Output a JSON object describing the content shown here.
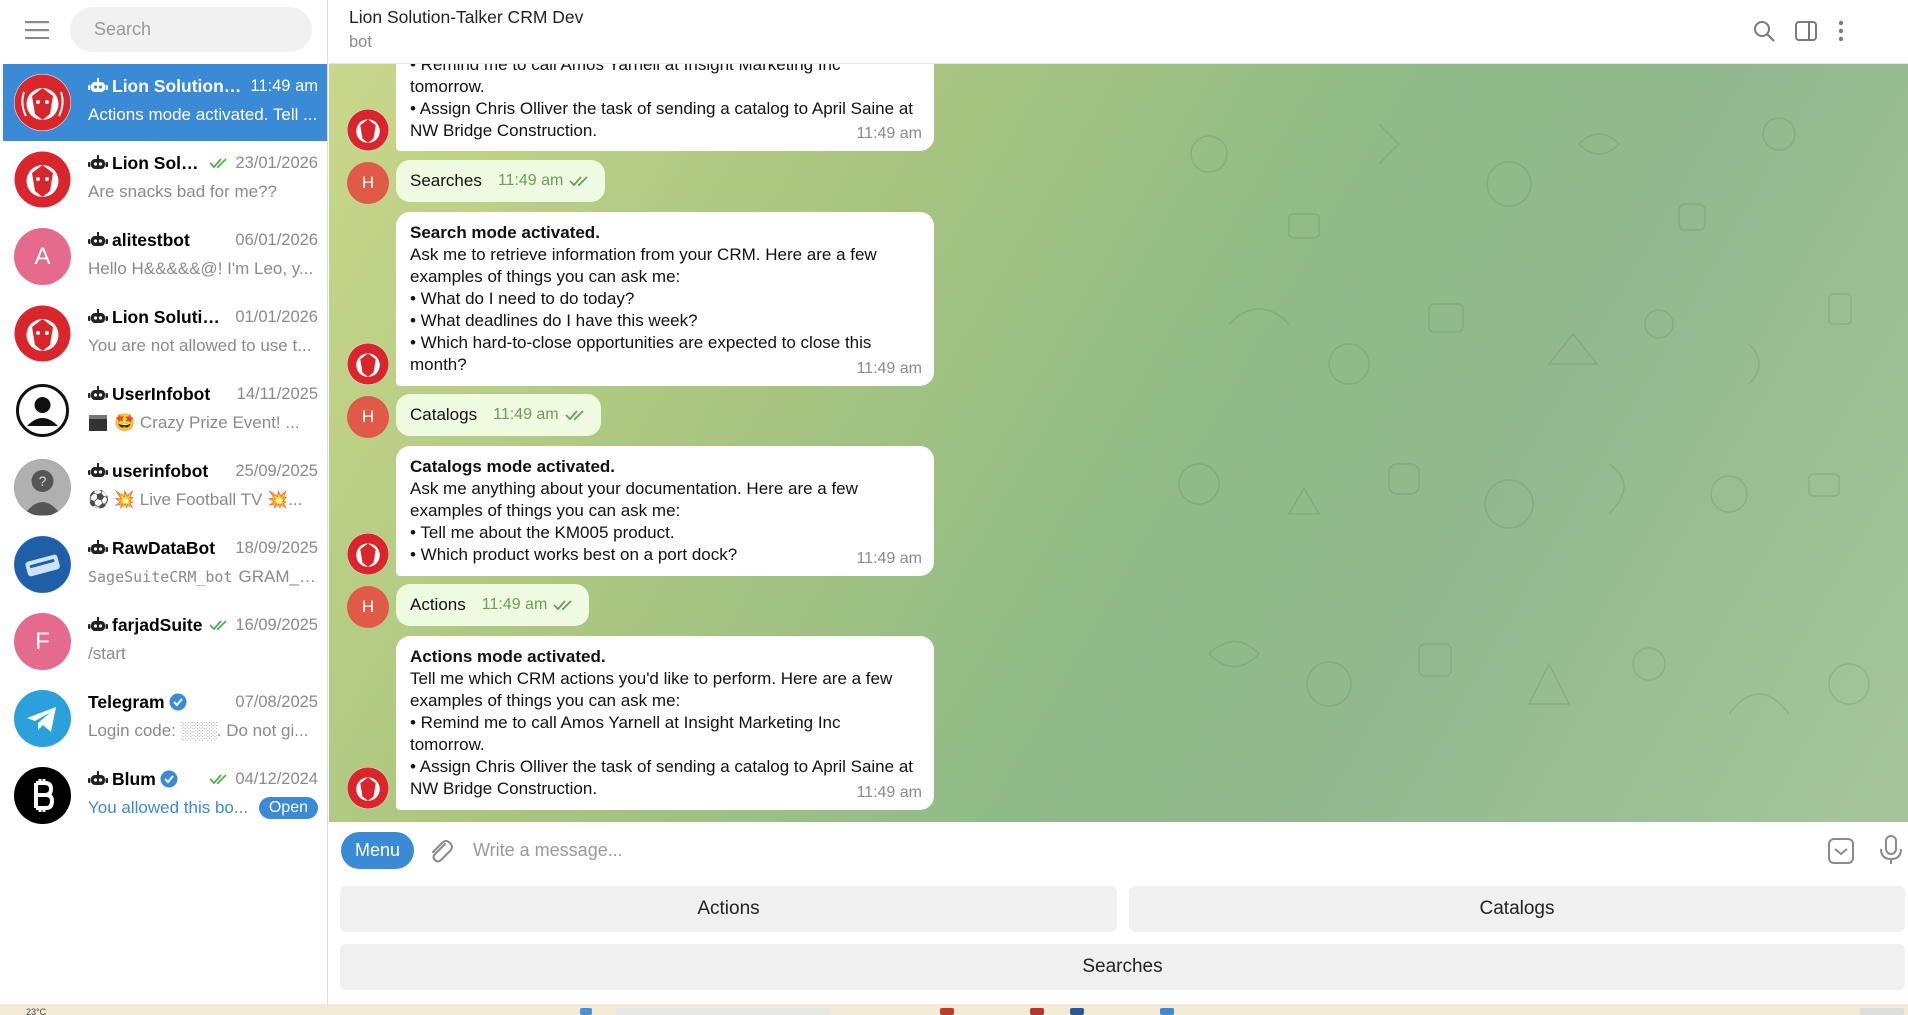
{
  "sidebar": {
    "search_placeholder": "Search",
    "chats": [
      {
        "name": "Lion Solution-T...",
        "date": "11:49 am",
        "preview": "Actions mode activated. Tell ...",
        "active": true,
        "avatar": "lion"
      },
      {
        "name": "Lion Solut...",
        "date": "23/01/2026",
        "preview": "Are snacks bad for me??",
        "read": true,
        "avatar": "lion"
      },
      {
        "name": "alitestbot",
        "date": "06/01/2026",
        "preview": "Hello H&&&&&@! I'm Leo, y...",
        "avatar_letter": "A"
      },
      {
        "name": "Lion Solution...",
        "date": "01/01/2026",
        "preview": "You are not allowed to use t...",
        "avatar": "lion"
      },
      {
        "name": "UserInfobot",
        "date": "14/11/2025",
        "preview": "🤩 Crazy Prize Event! ...",
        "avatar": "user-outline"
      },
      {
        "name": "userinfobot",
        "date": "25/09/2025",
        "preview": "⚽ 💥 Live Football TV 💥...",
        "avatar": "user-gray"
      },
      {
        "name": "RawDataBot",
        "date": "18/09/2025",
        "preview_code": "SageSuiteCRM_bot",
        "preview": "GRAM_A...",
        "avatar": "rawdata"
      },
      {
        "name": "farjadSuite",
        "date": "16/09/2025",
        "preview": "/start",
        "read": true,
        "avatar_letter": "F"
      },
      {
        "name": "Telegram",
        "date": "07/08/2025",
        "preview": "Login code: ░░░. Do not gi...",
        "verified": true,
        "avatar": "telegram"
      },
      {
        "name": "Blum",
        "date": "04/12/2024",
        "preview": "You allowed this bo...",
        "read": true,
        "verified": true,
        "open_label": "Open",
        "avatar": "blum"
      }
    ]
  },
  "header": {
    "title": "Lion Solution-Talker CRM Dev",
    "subtitle": "bot"
  },
  "messages": {
    "top_partial": {
      "line1": "• Remind me to call Amos Yarnell at Insight Marketing Inc",
      "line2": "tomorrow.",
      "line3": "• Assign Chris Olliver the task of sending a catalog to April Saine at",
      "line4": "NW Bridge Construction.",
      "time": "11:49 am"
    },
    "user_searches": {
      "text": "Searches",
      "time": "11:49 am",
      "avatar_letter": "H"
    },
    "bot_search": {
      "title": "Search mode activated.",
      "line1": "Ask me to retrieve information from your CRM. Here are a few",
      "line2": "examples of things you can ask me:",
      "line3": "• What do I need to do today?",
      "line4": "• What deadlines do I have this week?",
      "line5": "• Which hard-to-close opportunities are expected to close this",
      "line6": "month?",
      "time": "11:49 am"
    },
    "user_catalogs": {
      "text": "Catalogs",
      "time": "11:49 am",
      "avatar_letter": "H"
    },
    "bot_catalogs": {
      "title": "Catalogs mode activated.",
      "line1": "Ask me anything about your documentation. Here are a few",
      "line2": "examples of things you can ask me:",
      "line3": "• Tell me about the KM005 product.",
      "line4": "• Which product works best on a port dock?",
      "time": "11:49 am"
    },
    "user_actions": {
      "text": "Actions",
      "time": "11:49 am",
      "avatar_letter": "H"
    },
    "bot_actions": {
      "title": "Actions mode activated.",
      "line1": "Tell me which CRM actions you'd like to perform. Here are a few",
      "line2": "examples of things you can ask me:",
      "line3": "• Remind me to call Amos Yarnell at Insight Marketing Inc",
      "line4": "tomorrow.",
      "line5": "• Assign Chris Olliver the task of sending a catalog to April Saine at",
      "line6": "NW Bridge Construction.",
      "time": "11:49 am"
    }
  },
  "composer": {
    "menu_label": "Menu",
    "placeholder": "Write a message..."
  },
  "keyboard": {
    "actions": "Actions",
    "catalogs": "Catalogs",
    "searches": "Searches"
  },
  "taskbar": {
    "temperature": "23°C"
  },
  "colors": {
    "accent": "#3a8ad6",
    "user_bubble": "#eefbe0",
    "avatar_h": "#e05a47",
    "avatar_pink": "#e46b8d"
  }
}
